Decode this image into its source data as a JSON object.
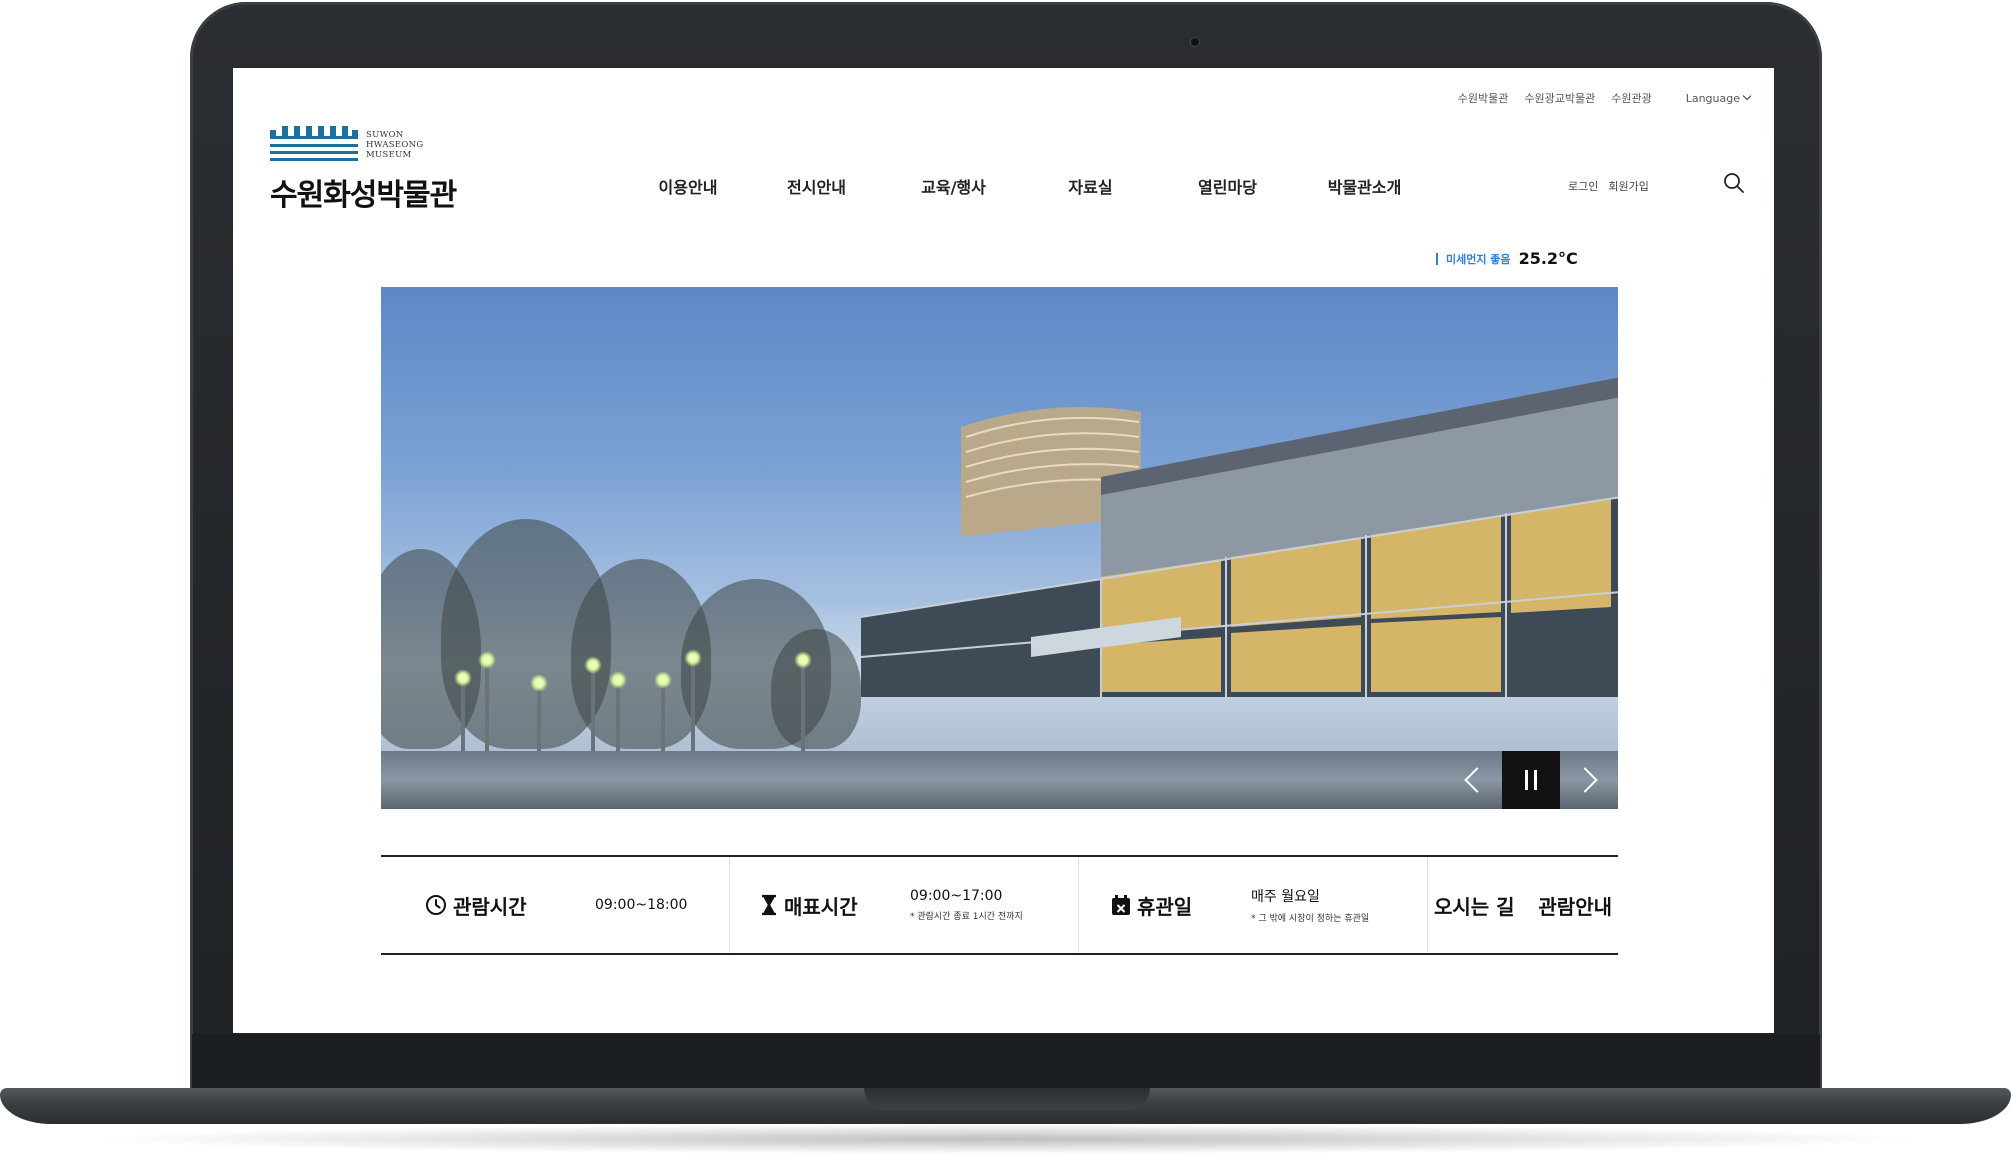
{
  "util_links": [
    "수원박물관",
    "수원광교박물관",
    "수원관광"
  ],
  "language_label": "Language",
  "logo": {
    "en_lines": [
      "SUWON",
      "HWASEONG",
      "MUSEUM"
    ],
    "ko": "수원화성박물관"
  },
  "gnb": [
    "이용안내",
    "전시안내",
    "교육/행사",
    "자료실",
    "열린마당",
    "박물관소개"
  ],
  "member": {
    "login": "로그인",
    "join": "회원가입"
  },
  "weather": {
    "dust": "미세먼지 좋음",
    "temp": "25.2°C"
  },
  "info": {
    "hours": {
      "label": "관람시간",
      "value": "09:00~18:00"
    },
    "ticket": {
      "label": "매표시간",
      "value": "09:00~17:00",
      "note": "* 관람시간 종료 1시간 전까지"
    },
    "closed": {
      "label": "휴관일",
      "value": "매주 월요일",
      "note": "* 그 밖에 시장이 정하는 휴관일"
    },
    "links": [
      "오시는 길",
      "관람안내"
    ]
  },
  "colors": {
    "accent_blue": "#2f7fd6",
    "logo_teal": "#1f6f9a",
    "text_dark": "#111111"
  },
  "icons": [
    "search-icon",
    "clock-icon",
    "hourglass-icon",
    "calendar-x-icon",
    "chevron-left-icon",
    "chevron-right-icon",
    "pause-icon"
  ]
}
